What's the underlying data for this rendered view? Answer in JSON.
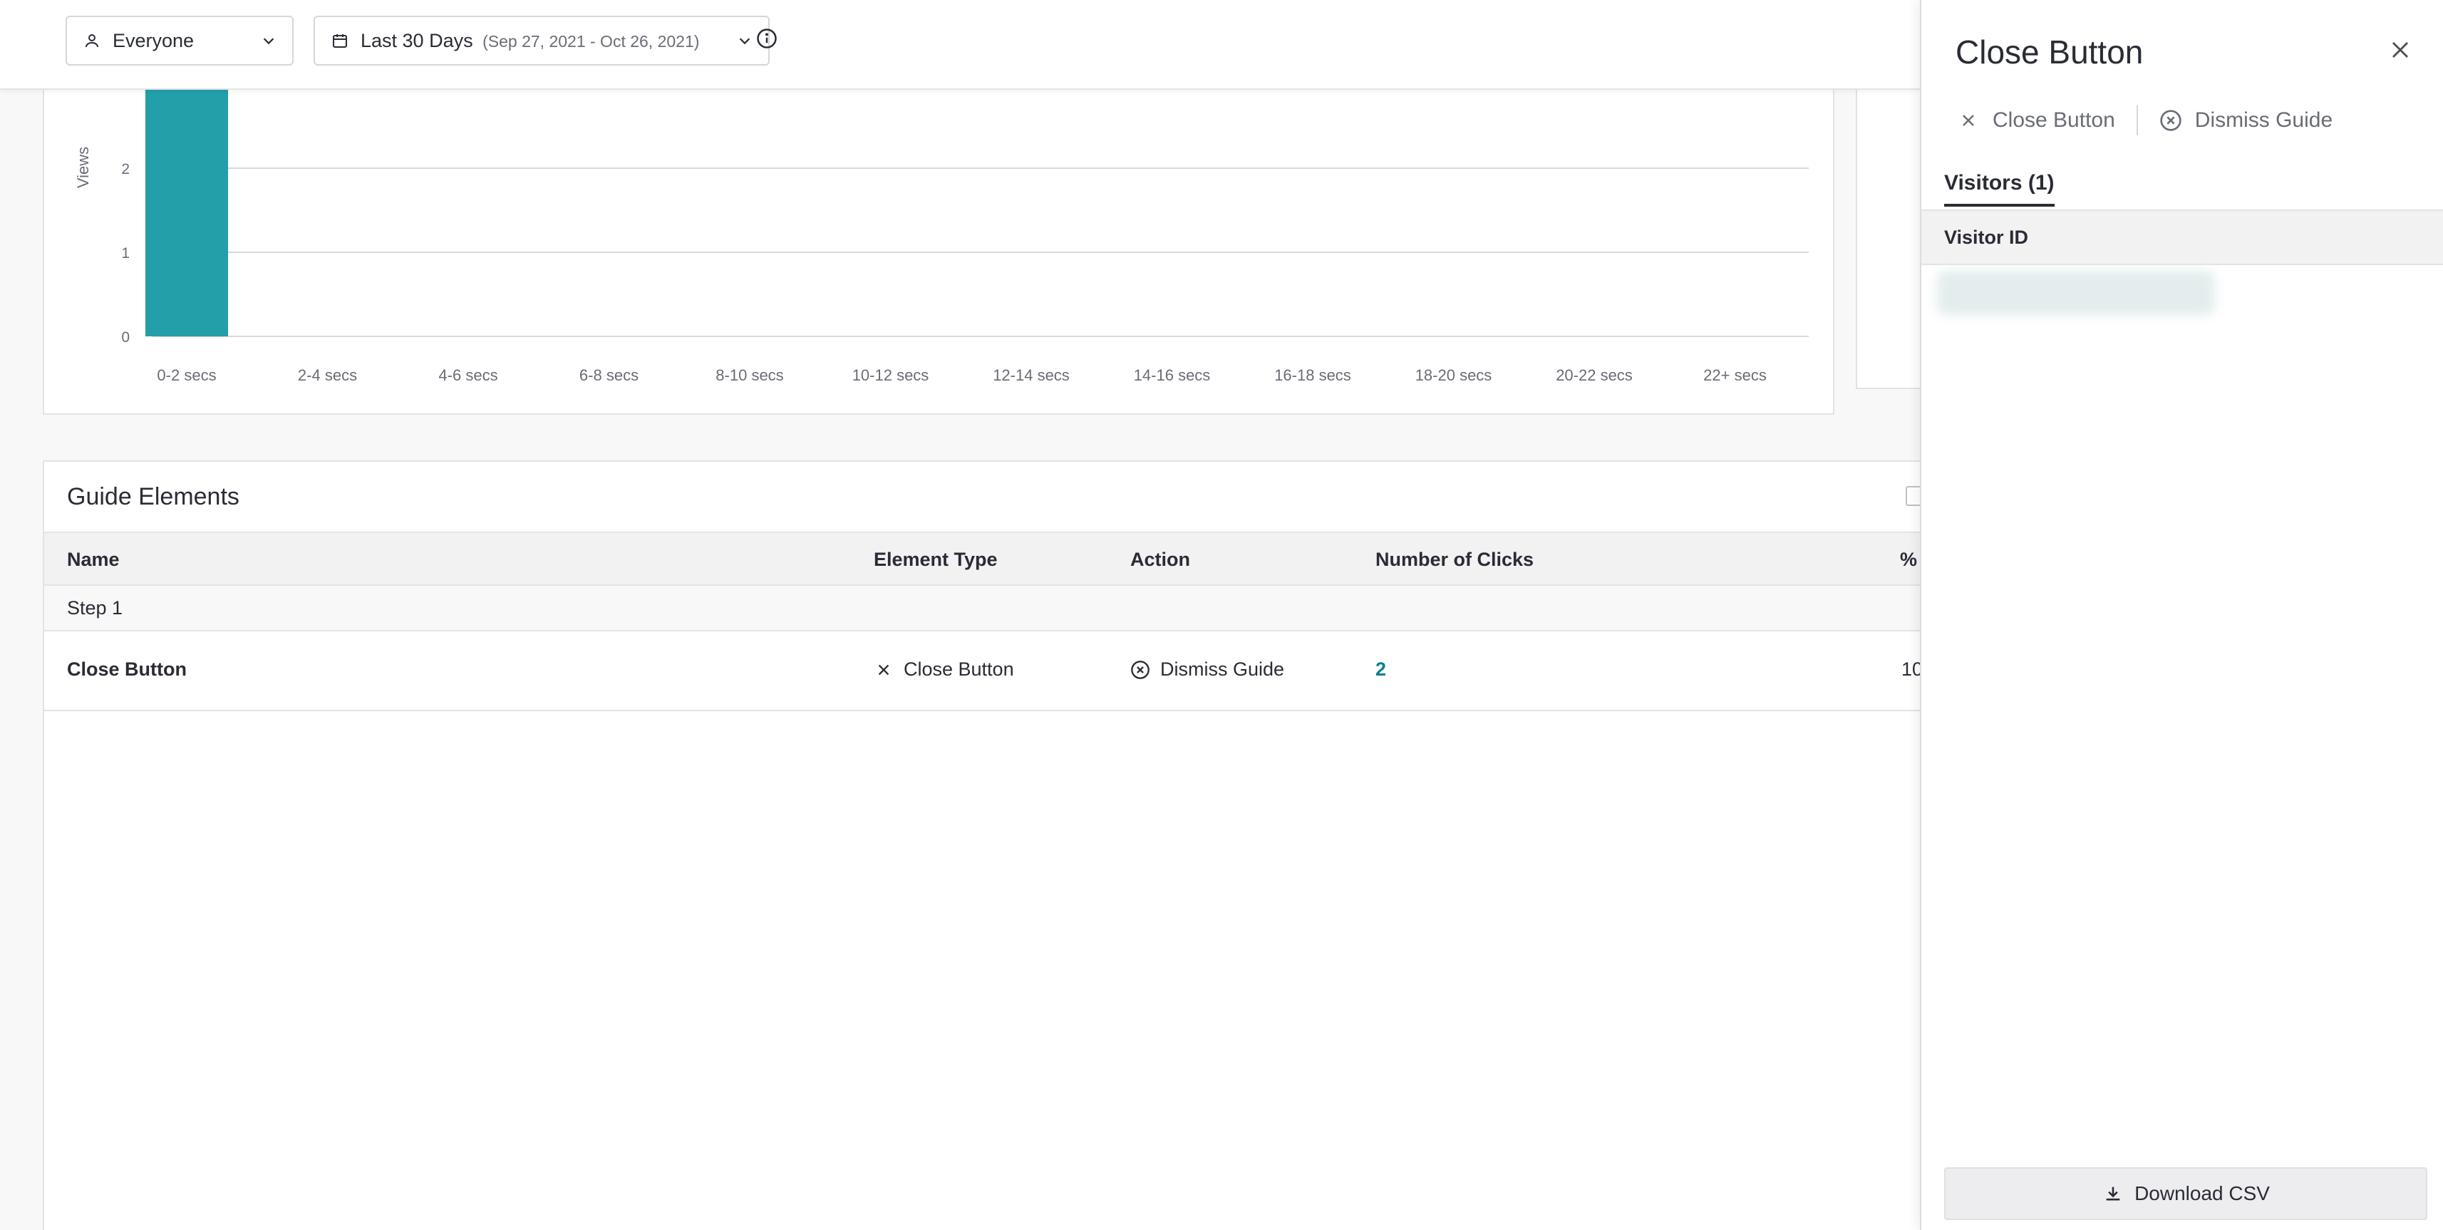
{
  "filters": {
    "segment_label": "Everyone",
    "date_label": "Last 30 Days",
    "date_range": "(Sep 27, 2021 - Oct 26, 2021)"
  },
  "chart_data": {
    "type": "bar",
    "ylabel": "Views",
    "xlabel": "",
    "ylim": [
      0,
      3
    ],
    "y_ticks": [
      "0",
      "1",
      "2"
    ],
    "categories": [
      "0-2 secs",
      "2-4 secs",
      "4-6 secs",
      "6-8 secs",
      "8-10 secs",
      "10-12 secs",
      "12-14 secs",
      "14-16 secs",
      "16-18 secs",
      "18-20 secs",
      "20-22 secs",
      "22+ secs"
    ],
    "values": [
      3,
      0,
      0,
      0,
      0,
      0,
      0,
      0,
      0,
      0,
      0,
      0
    ],
    "bar_color": "#229fa9",
    "grid": true
  },
  "guide_elements": {
    "title": "Guide Elements",
    "columns": [
      "Name",
      "Element Type",
      "Action",
      "Number of Clicks",
      "%"
    ],
    "step_label": "Step 1",
    "rows": [
      {
        "name": "Close Button",
        "element_type": "Close Button",
        "element_type_icon": "x-icon",
        "action": "Dismiss Guide",
        "action_icon": "circle-x-icon",
        "clicks": "2",
        "percent": "10"
      }
    ]
  },
  "drawer": {
    "title": "Close Button",
    "element_type": "Close Button",
    "action": "Dismiss Guide",
    "tab_label": "Visitors (1)",
    "column_header": "Visitor ID",
    "download_label": "Download CSV"
  },
  "colors": {
    "accent": "#229fa9",
    "link": "#0d7e92",
    "text": "#2a2c35",
    "muted": "#6a6c75"
  }
}
